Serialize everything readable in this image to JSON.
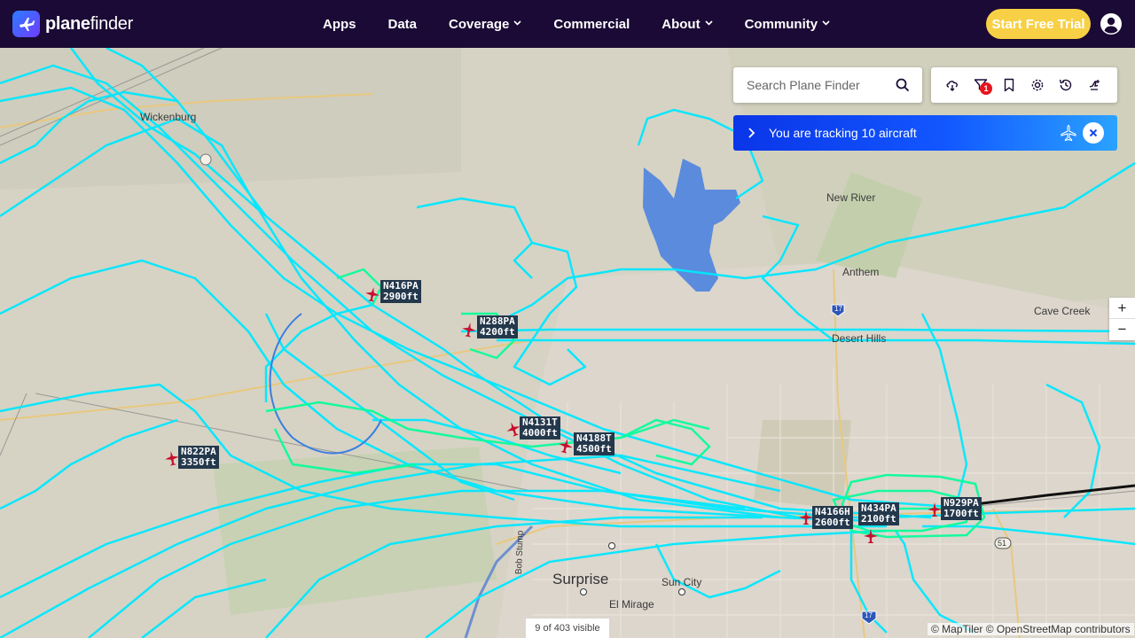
{
  "brand": {
    "bold": "plane",
    "light": "finder"
  },
  "nav": {
    "apps": "Apps",
    "data": "Data",
    "coverage": "Coverage",
    "commercial": "Commercial",
    "about": "About",
    "community": "Community"
  },
  "cta": {
    "trial": "Start Free Trial"
  },
  "search": {
    "placeholder": "Search Plane Finder"
  },
  "toolbar": {
    "filter_count": "1"
  },
  "tracking": {
    "text": "You are tracking 10 aircraft"
  },
  "zoom": {
    "in": "+",
    "out": "−"
  },
  "status": {
    "visible": "9 of 403 visible"
  },
  "attribution": "© MapTiler © OpenStreetMap contributors",
  "places": {
    "wickenburg": "Wickenburg",
    "new_river": "New River",
    "anthem": "Anthem",
    "cave_creek": "Cave Creek",
    "desert_hills": "Desert Hills",
    "surprise": "Surprise",
    "sun_city": "Sun City",
    "el_mirage": "El Mirage",
    "bob_stump": "Bob Stump",
    "hwy_17_top": "17",
    "hwy_17_bottom": "17",
    "hwy_51": "51"
  },
  "aircraft": [
    {
      "callsign": "N416PA",
      "altitude": "2900ft"
    },
    {
      "callsign": "N288PA",
      "altitude": "4200ft"
    },
    {
      "callsign": "N822PA",
      "altitude": "3350ft"
    },
    {
      "callsign": "N4131T",
      "altitude": "4000ft"
    },
    {
      "callsign": "N4188T",
      "altitude": "4500ft"
    },
    {
      "callsign": "N4166H",
      "altitude": "2600ft"
    },
    {
      "callsign": "N434PA",
      "altitude": "2100ft"
    },
    {
      "callsign": "N929PA",
      "altitude": "1700ft"
    }
  ],
  "colors": {
    "navbar": "#1a0a35",
    "trail": "#00e8ff",
    "trail_low": "#00ff99",
    "plane": "#c8102e",
    "tag": "#24384c",
    "cta": "#f7d046",
    "water": "#5b8bdc"
  }
}
